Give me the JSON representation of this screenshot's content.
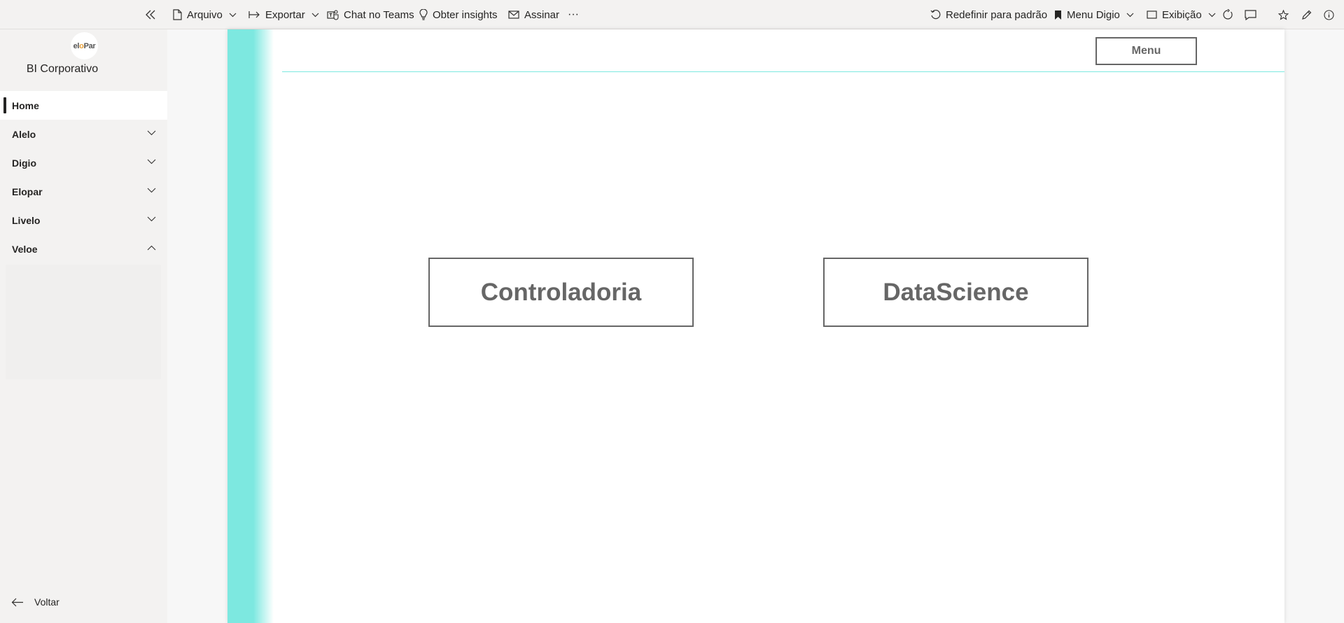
{
  "toolbar": {
    "file": "Arquivo",
    "export": "Exportar",
    "teams": "Chat no Teams",
    "insights": "Obter insights",
    "subscribe": "Assinar",
    "more": "···",
    "reset": "Redefinir para padrão",
    "bookmark": "Menu Digio",
    "view": "Exibição"
  },
  "sidebar": {
    "logo_text_a": "el",
    "logo_text_b": "o",
    "logo_text_c": "Par",
    "workspace": "BI Corporativo",
    "items": [
      {
        "label": "Home"
      },
      {
        "label": "Alelo"
      },
      {
        "label": "Digio"
      },
      {
        "label": "Elopar"
      },
      {
        "label": "Livelo"
      },
      {
        "label": "Veloe"
      }
    ],
    "back": "Voltar"
  },
  "report": {
    "menu_button": "Menu",
    "button_1": "Controladoria",
    "button_2": "DataScience"
  },
  "colors": {
    "accent_teal": "#7de8e0",
    "button_border": "#666666"
  }
}
